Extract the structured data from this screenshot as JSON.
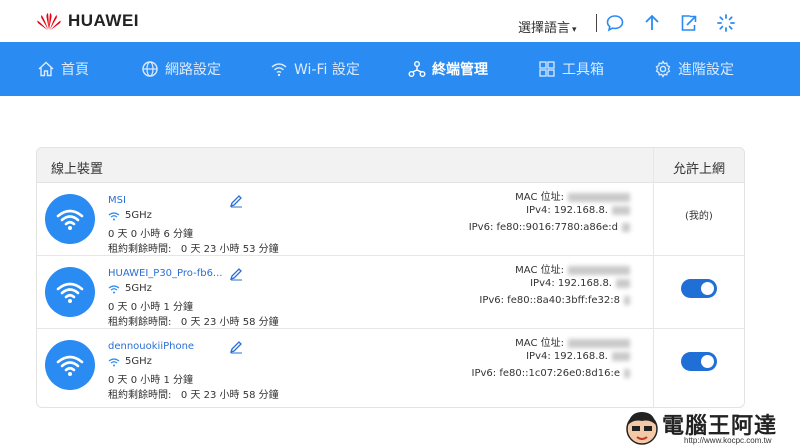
{
  "header": {
    "brand": "HUAWEI",
    "language_label": "選擇語言",
    "icons": [
      "message-icon",
      "upgrade-icon",
      "logout-icon",
      "loading-icon"
    ]
  },
  "nav": {
    "items": [
      {
        "label": "首頁",
        "icon": "home-icon"
      },
      {
        "label": "網路設定",
        "icon": "globe-icon"
      },
      {
        "label": "Wi-Fi 設定",
        "icon": "wifi-icon"
      },
      {
        "label": "終端管理",
        "icon": "devices-icon",
        "active": true
      },
      {
        "label": "工具箱",
        "icon": "toolbox-icon"
      },
      {
        "label": "進階設定",
        "icon": "gear-icon"
      }
    ]
  },
  "devices_panel": {
    "title": "線上裝置",
    "allow_header": "允許上網",
    "devices": [
      {
        "name": "MSI",
        "band": "5GHz",
        "online_time": "0 天 0 小時 6 分鐘",
        "lease": "租約剩餘時間:   0 天 23 小時 53 分鐘",
        "mac_label": "MAC 位址:",
        "ipv4": "IPv4: 192.168.8.",
        "ipv6": "IPv6: fe80::9016:7780:a86e:d",
        "allow_text": "(我的)",
        "allowed": true
      },
      {
        "name": "HUAWEI_P30_Pro-fb6...",
        "band": "5GHz",
        "online_time": "0 天 0 小時 1 分鐘",
        "lease": "租約剩餘時間:   0 天 23 小時 58 分鐘",
        "mac_label": "MAC 位址:",
        "ipv4": "IPv4: 192.168.8.",
        "ipv6": "IPv6: fe80::8a40:3bff:fe32:8",
        "allowed": true
      },
      {
        "name": "dennouokiiPhone",
        "band": "5GHz",
        "online_time": "0 天 0 小時 1 分鐘",
        "lease": "租約剩餘時間:   0 天 23 小時 58 分鐘",
        "mac_label": "MAC 位址:",
        "ipv4": "IPv4: 192.168.8.",
        "ipv6": "IPv6: fe80::1c07:26e0:8d16:e",
        "allowed": true
      }
    ]
  },
  "watermark": {
    "text": "電腦王阿達",
    "url": "http://www.kocpc.com.tw"
  },
  "colors": {
    "nav_bg": "#2a8bf2",
    "toggle_on": "#1f6fd6",
    "link": "#2a6fd6"
  }
}
